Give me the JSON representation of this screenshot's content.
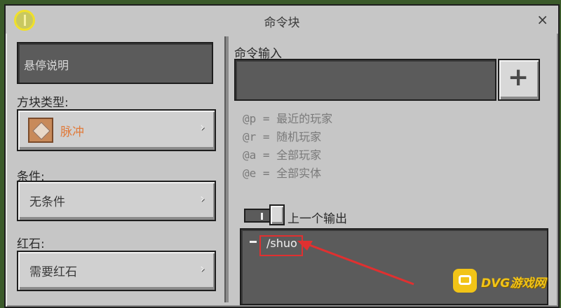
{
  "window": {
    "title": "命令块",
    "close_glyph": "×"
  },
  "left_panel": {
    "hover_note_placeholder": "悬停说明",
    "block_type_label": "方块类型:",
    "block_type_value": "脉冲",
    "condition_label": "条件:",
    "condition_value": "无条件",
    "redstone_label": "红石:",
    "redstone_value": "需要红石",
    "chevron": "›"
  },
  "right_panel": {
    "command_input_label": "命令输入",
    "command_input_value": "",
    "add_button_glyph": "+",
    "hints": [
      "@p = 最近的玩家",
      "@r = 随机玩家",
      "@a = 全部玩家",
      "@e = 全部实体"
    ],
    "previous_output_label": "上一个输出",
    "previous_output_toggle_on": false,
    "output_value": "/shuo"
  },
  "watermark": {
    "text": "DVG游戏网"
  },
  "colors": {
    "block_type_accent": "#e07a3a",
    "annotation_red": "#e03030",
    "watermark_gold": "#f2c417"
  },
  "icons": {
    "help": "help-icon",
    "close": "close-icon",
    "block": "impulse-command-block-icon",
    "add": "plus-icon"
  }
}
